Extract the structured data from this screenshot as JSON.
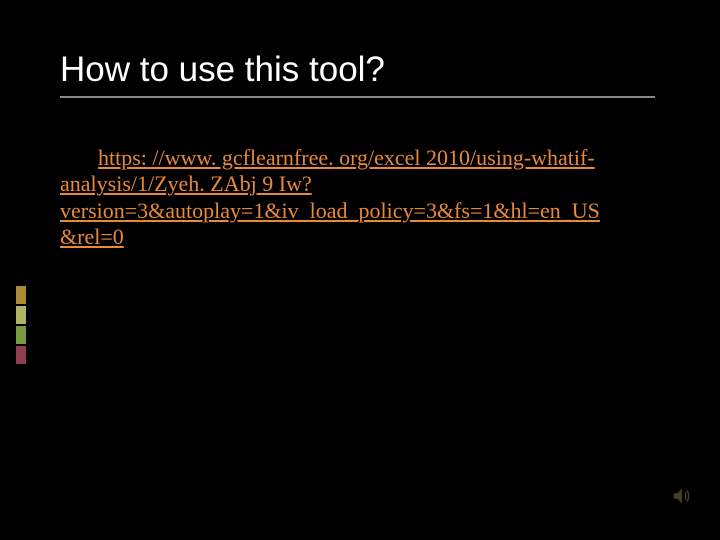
{
  "slide": {
    "title": "How to use this tool?",
    "link_text": "https: //www. gcflearnfree. org/excel 2010/using-whatif-analysis/1/Zyeh. ZAbj 9 Iw? version=3&autoplay=1&iv_load_policy=3&fs=1&hl=en_US&rel=0",
    "link_href": "https://www.gcflearnfree.org/excel2010/using-whatif-analysis/1/ZyehZAbj9Iw?version=3&autoplay=1&iv_load_policy=3&fs=1&hl=en_US&rel=0"
  }
}
